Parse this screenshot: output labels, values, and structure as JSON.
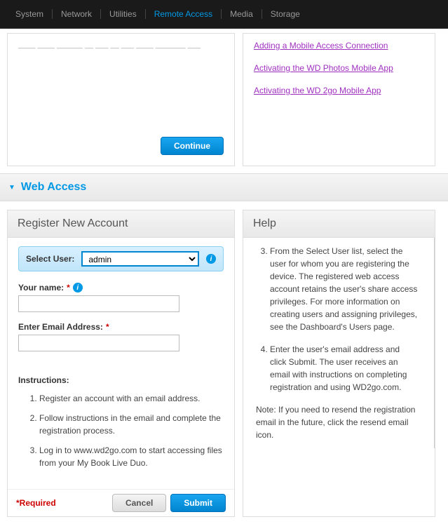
{
  "nav": {
    "items": [
      "System",
      "Network",
      "Utilities",
      "Remote Access",
      "Media",
      "Storage"
    ],
    "active_index": 3
  },
  "top_left": {
    "truncated_text": "____ ____ ______ __ ___ __ ___ ____ _______ ___"
  },
  "top_right": {
    "links": [
      "Adding a Mobile Access Connection",
      "Activating the WD Photos Mobile App",
      "Activating the WD 2go Mobile App"
    ]
  },
  "continue_btn": "Continue",
  "section": {
    "title": "Web Access"
  },
  "register": {
    "title": "Register New Account",
    "select_user_label": "Select User:",
    "select_user_value": "admin",
    "name_label": "Your name:",
    "name_value": "",
    "email_label": "Enter Email Address:",
    "email_value": "",
    "instructions_label": "Instructions:",
    "instructions": [
      "Register an account with an email address.",
      "Follow instructions in the email and complete the registration process.",
      "Log in to www.wd2go.com to start accessing files from your My Book Live Duo."
    ],
    "required_label": "*Required",
    "cancel_btn": "Cancel",
    "submit_btn": "Submit"
  },
  "help": {
    "title": "Help",
    "items": [
      {
        "n": "3",
        "text": "From the Select User list, select the user for whom you are registering the device. The registered web access account retains the user's share access privileges. For more information on creating users and assigning privileges, see the Dashboard's Users page."
      },
      {
        "n": "4",
        "text": "Enter the user's email address and click Submit. The user receives an email with instructions on completing registration and using WD2go.com."
      }
    ],
    "note": "Note: If you need to resend the registration email in the future, click the resend email icon."
  }
}
